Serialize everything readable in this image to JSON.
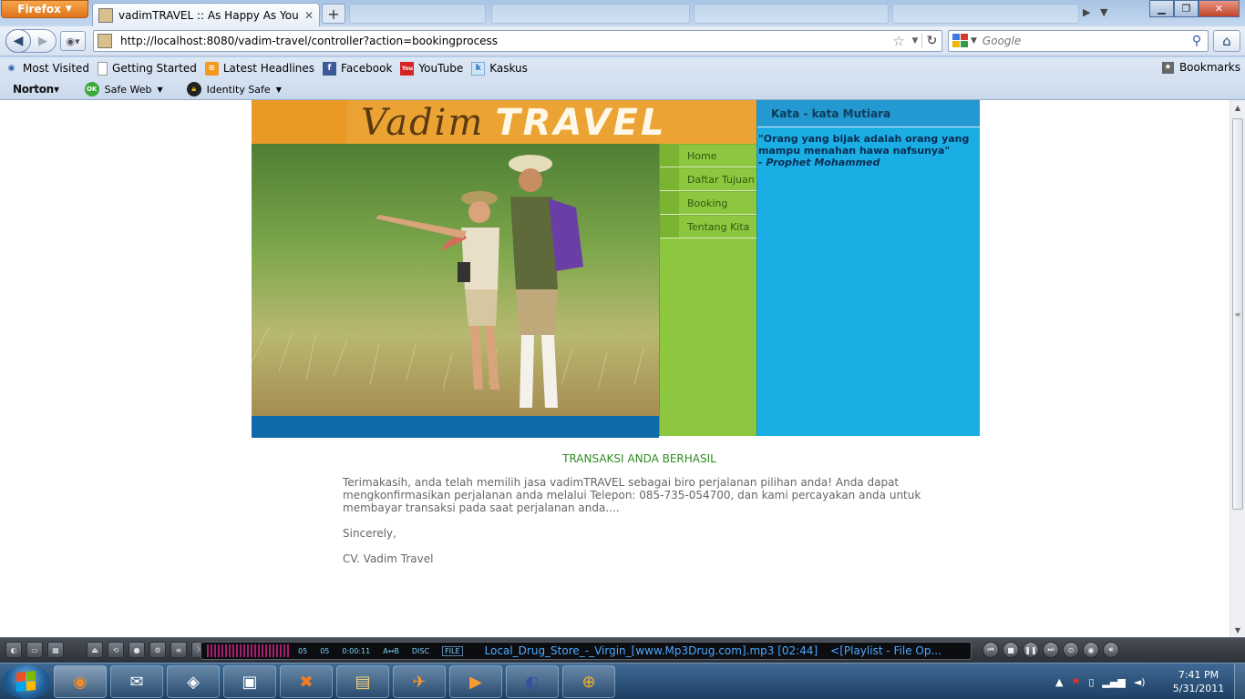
{
  "browser": {
    "app_button": "Firefox",
    "tab_title": "vadimTRAVEL :: As Happy As Your Trip",
    "new_tab": "+",
    "url": "http://localhost:8080/vadim-travel/controller?action=bookingprocess",
    "search_placeholder": "Google",
    "bookmarks": [
      "Most Visited",
      "Getting Started",
      "Latest Headlines",
      "Facebook",
      "YouTube",
      "Kaskus"
    ],
    "bookmarks_menu": "Bookmarks",
    "norton": {
      "logo": "Norton",
      "safe_web": "Safe Web",
      "identity_safe": "Identity Safe",
      "ok_badge": "OK"
    }
  },
  "site": {
    "logo_part1": "Vadim",
    "logo_part2": "TRAVEL",
    "menu": [
      "Home",
      "Daftar Tujuan",
      "Booking",
      "Tentang Kita"
    ],
    "quote_header": "Kata - kata Mutiara",
    "quote": "\"Orang yang bijak adalah orang yang mampu menahan hawa nafsunya\"",
    "quote_author": "- Prophet Mohammed",
    "success_title": "TRANSAKSI ANDA BERHASIL",
    "message": "Terimakasih, anda telah memilih jasa vadimTRAVEL sebagai biro perjalanan pilihan anda! Anda dapat mengkonfirmasikan perjalanan anda melalui Telepon: 085-735-054700, dan kami percayakan anda untuk membayar transaksi pada saat perjalanan anda....",
    "sincerely": "Sincerely,",
    "signature": "CV. Vadim Travel"
  },
  "player": {
    "counter_a": "05",
    "counter_b": "05",
    "elapsed": "0:00:11",
    "mode_label": "A↔B",
    "disc_label": "DISC",
    "file_label": "FILE",
    "track": "Local_Drug_Store_-_Virgin_[www.Mp3Drug.com].mp3  [02:44]",
    "playlist": "<[Playlist - File Op..."
  },
  "taskbar": {
    "time": "7:41 PM",
    "date": "5/31/2011"
  },
  "colors": {
    "header_orange": "#eba433",
    "menu_green": "#8dc63f",
    "quote_blue": "#1baee4",
    "hero_strip": "#0e6aa8",
    "success_green": "#2e8b20"
  }
}
